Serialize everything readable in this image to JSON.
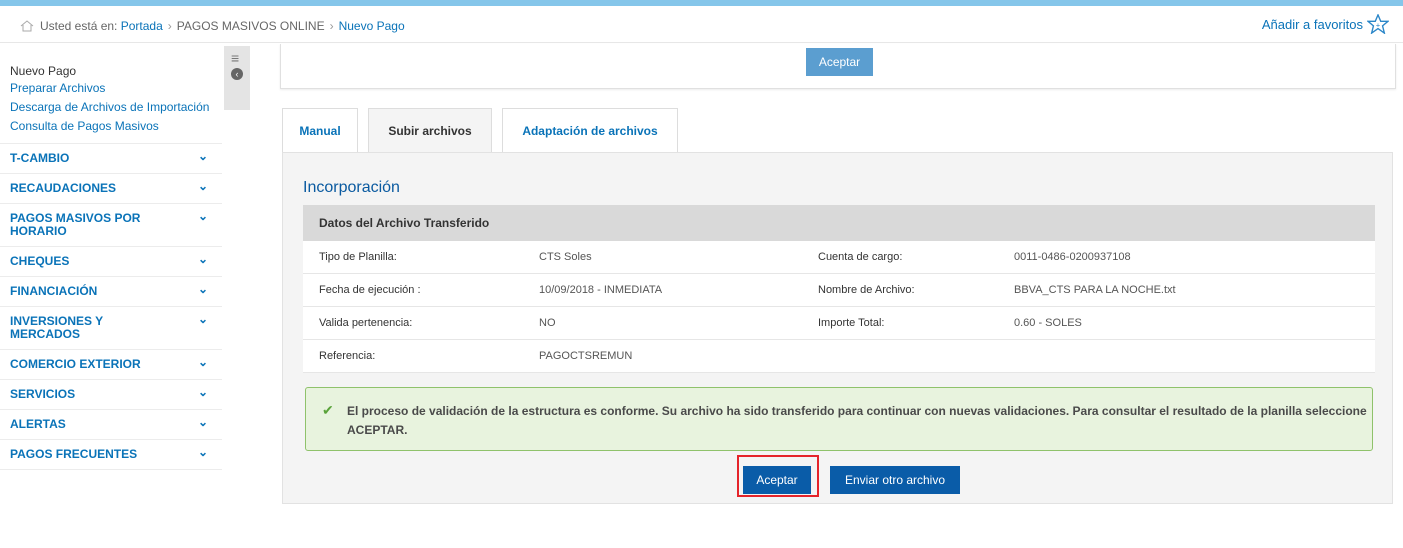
{
  "breadcrumb": {
    "prefix": "Usted está en:",
    "items": [
      "Portada",
      "PAGOS MASIVOS ONLINE",
      "Nuevo Pago"
    ]
  },
  "favorites": {
    "label": "Añadir a favoritos",
    "icon": "star-icon"
  },
  "sidebar": {
    "title": "Nuevo Pago",
    "links": [
      "Preparar Archivos",
      "Descarga de Archivos de Importación",
      "Consulta de Pagos Masivos"
    ],
    "menu": [
      "T-CAMBIO",
      "RECAUDACIONES",
      "PAGOS MASIVOS POR HORARIO",
      "CHEQUES",
      "FINANCIACIÓN",
      "INVERSIONES Y MERCADOS",
      "COMERCIO EXTERIOR",
      "SERVICIOS",
      "ALERTAS",
      "PAGOS FRECUENTES"
    ]
  },
  "top_panel": {
    "accept_label": "Aceptar"
  },
  "tabs": [
    "Manual",
    "Subir archivos",
    "Adaptación de archivos"
  ],
  "section": {
    "title": "Incorporación",
    "table_header": "Datos del Archivo Transferido",
    "rows": [
      [
        "Tipo de Planilla:",
        "CTS Soles",
        "Cuenta de cargo:",
        "0011-0486-0200937108"
      ],
      [
        "Fecha de ejecución :",
        "10/09/2018 - INMEDIATA",
        "Nombre de Archivo:",
        "BBVA_CTS PARA LA NOCHE.txt"
      ],
      [
        "Valida pertenencia:",
        "NO",
        "Importe Total:",
        "0.60 - SOLES"
      ],
      [
        "Referencia:",
        "PAGOCTSREMUN",
        "",
        ""
      ]
    ]
  },
  "alert": {
    "message": "El proceso de validación de la estructura es conforme. Su archivo ha sido transferido para continuar con nuevas validaciones. Para consultar el resultado de la planilla seleccione ACEPTAR."
  },
  "actions": {
    "accept": "Aceptar",
    "send_other": "Enviar otro archivo"
  },
  "colors": {
    "accent": "#0a73b8",
    "button": "#0a5ca8",
    "success_bg": "#e8f3de",
    "highlight": "#e5242a"
  }
}
